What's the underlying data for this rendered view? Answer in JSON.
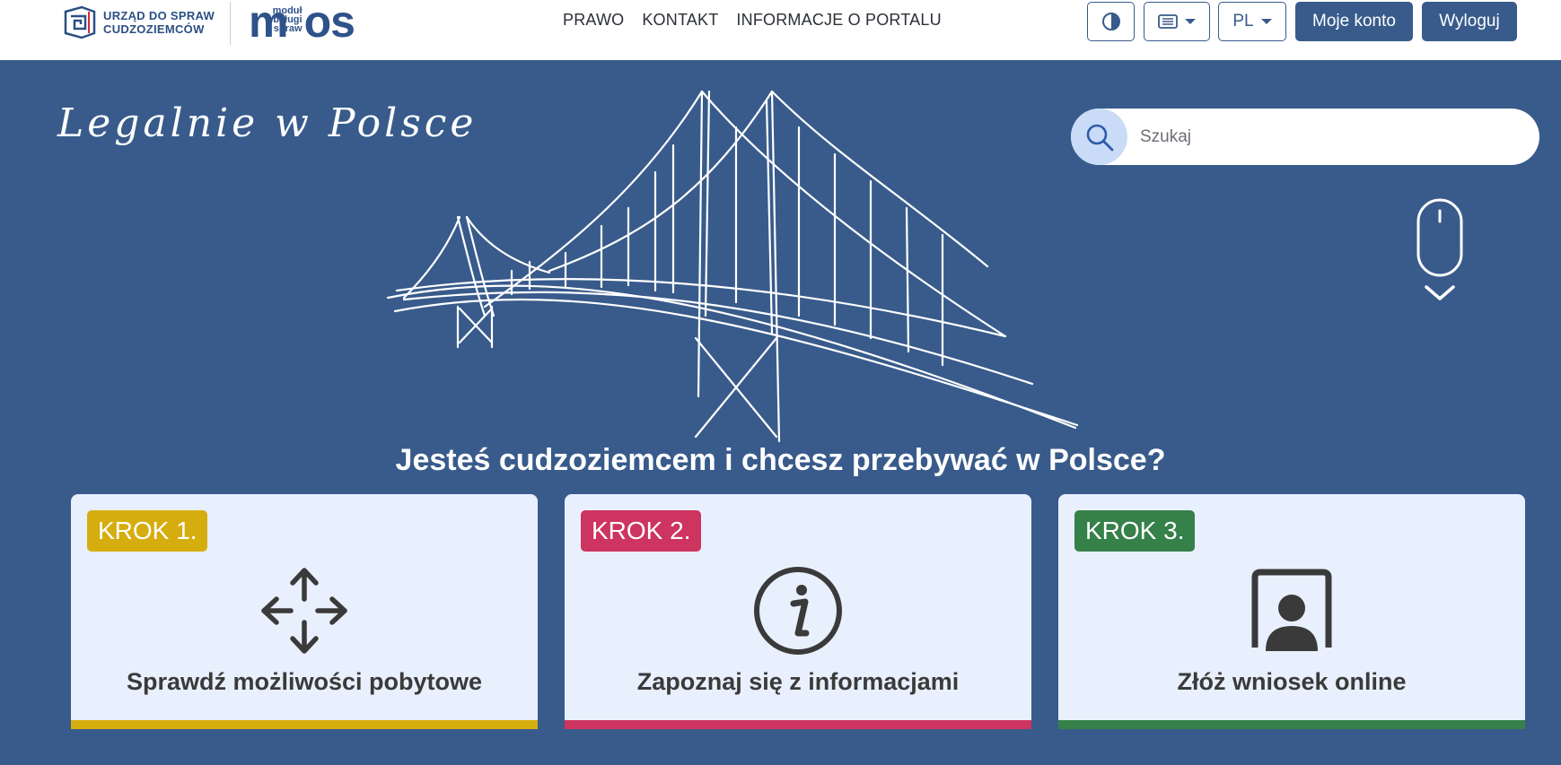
{
  "header": {
    "udsc_logo_line1": "URZĄD DO SPRAW",
    "udsc_logo_line2": "CUDZOZIEMCÓW",
    "mos_logo_m": "m",
    "mos_logo_small1": "moduł",
    "mos_logo_small2": "obsługi",
    "mos_logo_small3": "spraw",
    "mos_logo_os": "os",
    "nav": [
      "PRAWO",
      "KONTAKT",
      "INFORMACJE O PORTALU"
    ],
    "contrast_icon": "contrast-icon",
    "view_icon": "list-view-icon",
    "language": "PL",
    "account_label": "Moje konto",
    "logout_label": "Wyloguj"
  },
  "hero": {
    "tagline": "Legalnie w Polsce",
    "search_placeholder": "Szukaj",
    "question": "Jesteś cudzoziemcem i chcesz przebywać w Polsce?"
  },
  "cards": [
    {
      "step": "KROK 1.",
      "title": "Sprawdź możliwości pobytowe",
      "color": "#d6ad0f",
      "icon": "move-arrows-icon"
    },
    {
      "step": "KROK 2.",
      "title": "Zapoznaj się z informacjami",
      "color": "#cd345f",
      "icon": "info-icon"
    },
    {
      "step": "KROK 3.",
      "title": "Złóż wniosek online",
      "color": "#36804a",
      "icon": "user-screen-icon"
    }
  ],
  "colors": {
    "brand": "#385b8b",
    "card_bg": "#e8f0fd"
  }
}
